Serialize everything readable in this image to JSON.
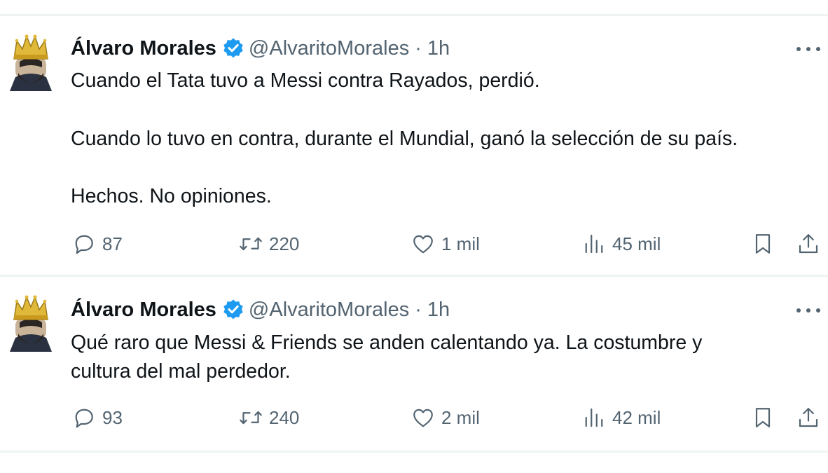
{
  "tweets": [
    {
      "author": "Álvaro Morales",
      "handle": "@AlvaritoMorales",
      "separator": "·",
      "time": "1h",
      "lines": [
        "Cuando el Tata tuvo a Messi contra Rayados, perdió.",
        "Cuando lo tuvo en contra, durante el Mundial, ganó la selección de su país.",
        "Hechos. No opiniones."
      ],
      "replies": "87",
      "retweets": "220",
      "likes": "1 mil",
      "views": "45 mil"
    },
    {
      "author": "Álvaro Morales",
      "handle": "@AlvaritoMorales",
      "separator": "·",
      "time": "1h",
      "lines": [
        "Qué raro que Messi & Friends se anden calentando ya. La costumbre y",
        "cultura del mal perdedor."
      ],
      "replies": "93",
      "retweets": "240",
      "likes": "2 mil",
      "views": "42 mil"
    }
  ],
  "colors": {
    "text": "#0f1419",
    "secondary": "#536471",
    "verified": "#1d9bf0",
    "separator": "#eff3f4"
  },
  "icons": [
    "avatar-crowned-man",
    "verified-badge-icon",
    "more-icon",
    "reply-icon",
    "retweet-icon",
    "like-icon",
    "views-icon",
    "bookmark-icon",
    "share-icon"
  ]
}
